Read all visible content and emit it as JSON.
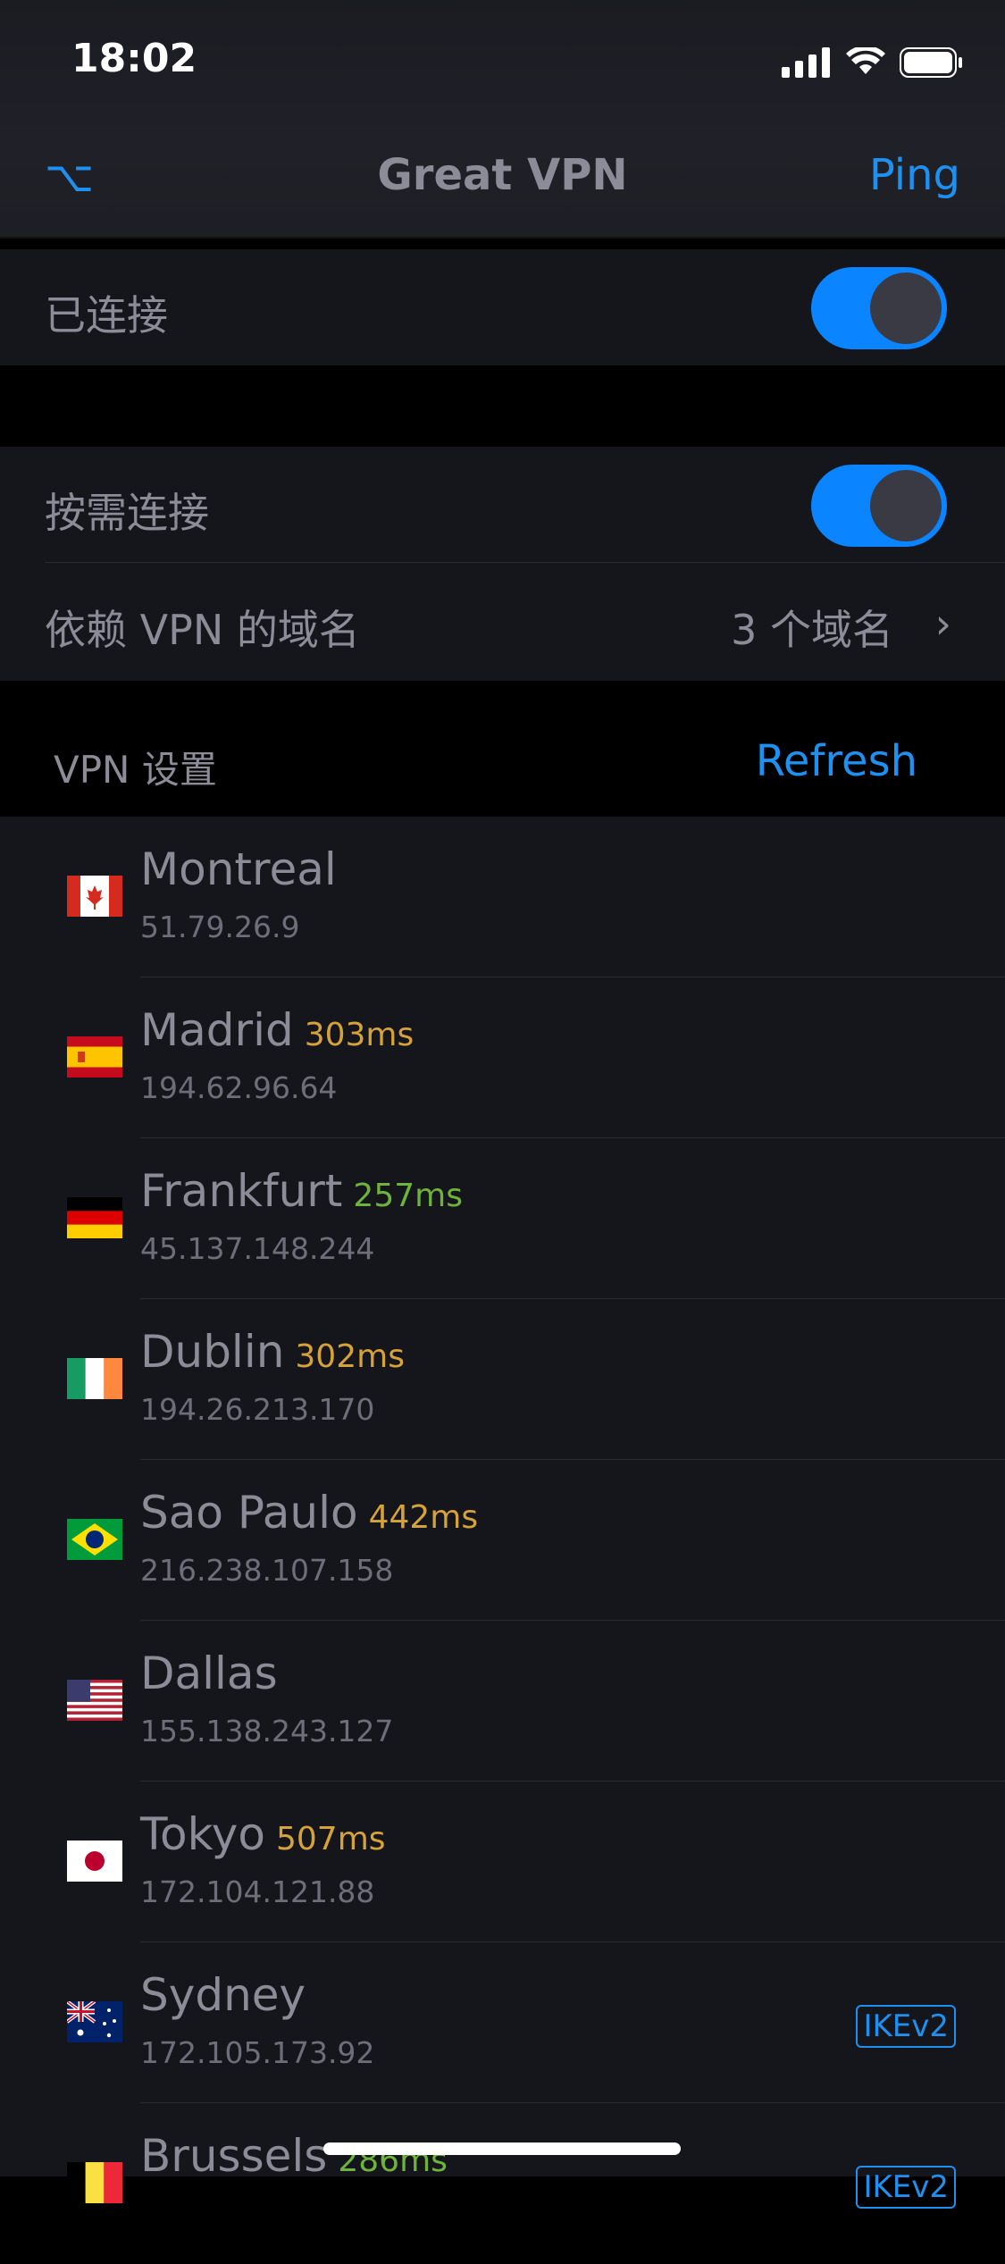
{
  "status": {
    "time": "18:02"
  },
  "nav": {
    "left_icon": "option-key-icon",
    "left_glyph": "⌥",
    "title": "Great VPN",
    "right_action": "Ping"
  },
  "settings": {
    "connected_label": "已连接",
    "connected_on": true,
    "ondemand_label": "按需连接",
    "ondemand_on": true,
    "domains_label": "依赖 VPN 的域名",
    "domains_value": "3 个域名"
  },
  "servers_section": {
    "title": "VPN 设置",
    "action": "Refresh"
  },
  "servers": [
    {
      "city": "Montreal",
      "ping": "",
      "ping_status": "",
      "ip": "51.79.26.9",
      "flag": "canada",
      "badge": ""
    },
    {
      "city": "Madrid",
      "ping": "303ms",
      "ping_status": "warn",
      "ip": "194.62.96.64",
      "flag": "spain",
      "badge": ""
    },
    {
      "city": "Frankfurt",
      "ping": "257ms",
      "ping_status": "good",
      "ip": "45.137.148.244",
      "flag": "germany",
      "badge": ""
    },
    {
      "city": "Dublin",
      "ping": "302ms",
      "ping_status": "warn",
      "ip": "194.26.213.170",
      "flag": "ireland",
      "badge": ""
    },
    {
      "city": "Sao Paulo",
      "ping": "442ms",
      "ping_status": "warn",
      "ip": "216.238.107.158",
      "flag": "brazil",
      "badge": ""
    },
    {
      "city": "Dallas",
      "ping": "",
      "ping_status": "",
      "ip": "155.138.243.127",
      "flag": "usa",
      "badge": ""
    },
    {
      "city": "Tokyo",
      "ping": "507ms",
      "ping_status": "warn",
      "ip": "172.104.121.88",
      "flag": "japan",
      "badge": ""
    },
    {
      "city": "Sydney",
      "ping": "",
      "ping_status": "",
      "ip": "172.105.173.92",
      "flag": "australia",
      "badge": "IKEv2"
    },
    {
      "city": "Brussels",
      "ping": "286ms",
      "ping_status": "good",
      "ip": "",
      "flag": "belgium",
      "badge": "IKEv2"
    }
  ],
  "colors": {
    "accent": "#1e90f0",
    "toggle_on": "#0a84ff",
    "ping_warn": "#d6a23a",
    "ping_good": "#6fb43a"
  }
}
